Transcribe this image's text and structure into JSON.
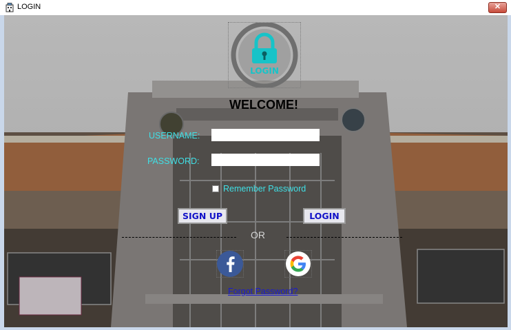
{
  "window": {
    "title": "LOGIN",
    "close_glyph": "✕",
    "app_icon": "building-icon"
  },
  "logo": {
    "text": "LOGIN",
    "icon": "padlock-icon",
    "ring_color": "#6f6f6f",
    "accent_color": "#17c3c8"
  },
  "welcome": "WELCOME!",
  "form": {
    "username_label": "USERNAME:",
    "username_value": "",
    "password_label": "PASSWORD:",
    "password_value": "",
    "remember_label": "Remember Password",
    "remember_checked": false
  },
  "buttons": {
    "signup": "SIGN UP",
    "login": "LOGIN"
  },
  "separator_text": "OR",
  "social": {
    "facebook_icon": "facebook-icon",
    "google_icon": "google-icon"
  },
  "forgot_link": "Forgot Password?",
  "colors": {
    "label_color": "#3fe0e6",
    "button_text": "#1212c8",
    "link_color": "#1a1ad0"
  }
}
